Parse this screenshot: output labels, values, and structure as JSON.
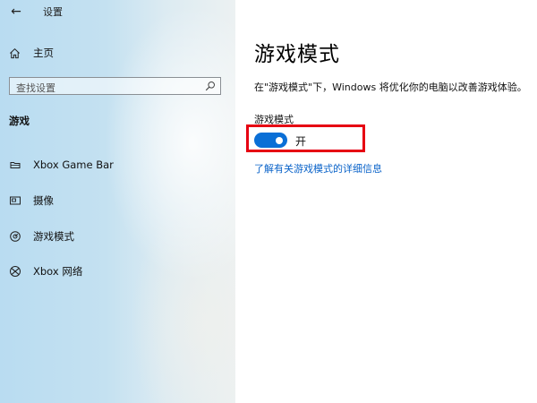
{
  "window": {
    "title": "设置",
    "back_icon": "back-arrow-icon"
  },
  "sidebar": {
    "home_label": "主页",
    "search": {
      "placeholder": "查找设置",
      "value": ""
    },
    "section_title": "游戏",
    "items": [
      {
        "label": "Xbox Game Bar",
        "icon": "game-bar-icon"
      },
      {
        "label": "摄像",
        "icon": "capture-icon"
      },
      {
        "label": "游戏模式",
        "icon": "game-mode-icon"
      },
      {
        "label": "Xbox 网络",
        "icon": "xbox-icon"
      }
    ]
  },
  "main": {
    "title": "游戏模式",
    "description": "在\"游戏模式\"下，Windows 将优化你的电脑以改善游戏体验。",
    "setting_label": "游戏模式",
    "toggle": {
      "state": "开",
      "on": true
    },
    "link": "了解有关游戏模式的详细信息"
  },
  "colors": {
    "accent": "#0a6fd6",
    "link": "#0a63c9",
    "highlight": "#e60012"
  }
}
